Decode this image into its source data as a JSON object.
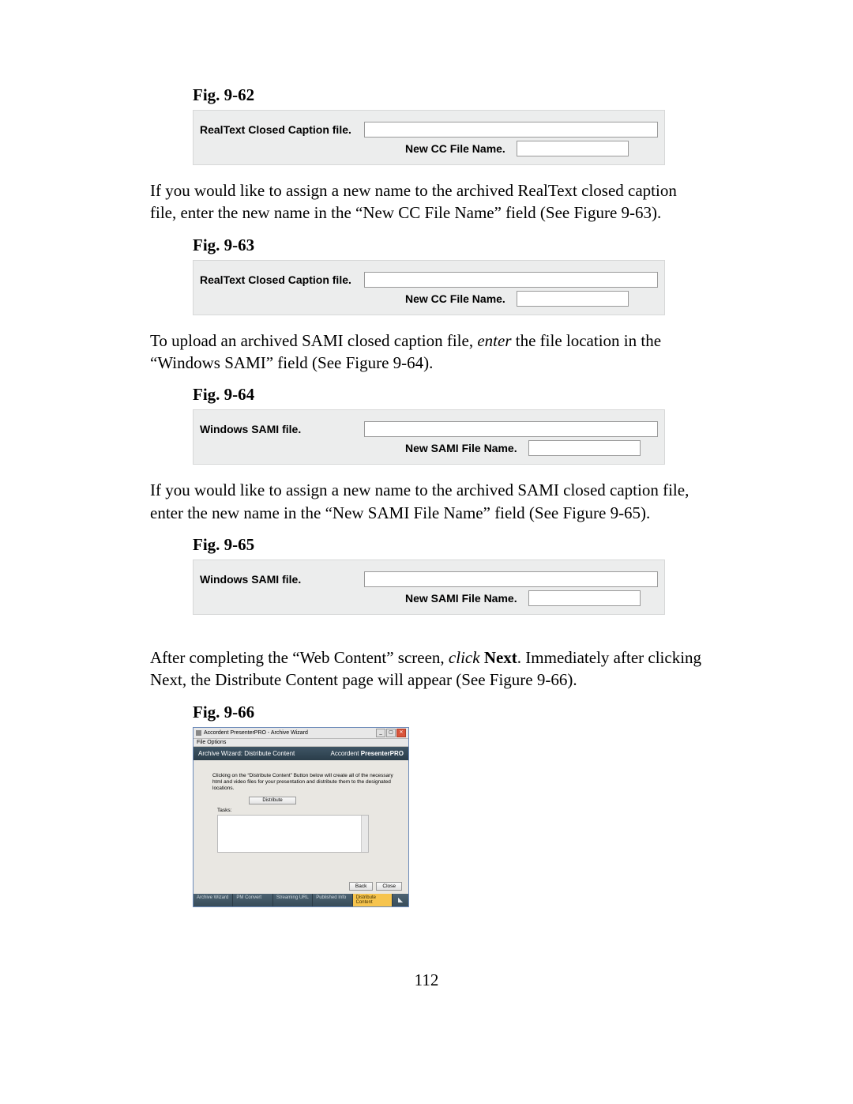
{
  "fig62": {
    "label": "Fig. 9-62",
    "row1_label": "RealText Closed Caption file.",
    "row2_label": "New CC File Name."
  },
  "para1_a": "If you would like to assign a new name to the archived RealText closed caption file, enter the ",
  "para1_b": "new name in the “New CC File Name” field (See Figure 9-63).",
  "fig63": {
    "label": "Fig. 9-63",
    "row1_label": "RealText Closed Caption file.",
    "row2_label": "New CC File Name."
  },
  "para2_a": "To upload an archived SAMI closed caption file, ",
  "para2_em": "enter",
  "para2_b": " the file location in the “Windows SAMI” field (See Figure 9-64).",
  "fig64": {
    "label": "Fig. 9-64",
    "row1_label": "Windows SAMI file.",
    "row2_label": "New SAMI File Name."
  },
  "para3": "If you would like to assign a new name to the archived SAMI closed caption file, enter the new name in the “New SAMI File Name” field (See Figure 9-65).",
  "fig65": {
    "label": "Fig. 9-65",
    "row1_label": "Windows SAMI file.",
    "row2_label": "New SAMI File Name."
  },
  "para4_a": "After completing the “Web Content” screen, ",
  "para4_em": "click",
  "para4_sp": " ",
  "para4_bold": "Next",
  "para4_b": ". Immediately after clicking Next, the Distribute Content page will appear (See Figure 9-66).",
  "fig66": {
    "label": "Fig. 9-66",
    "titlebar": "Accordent PresenterPRO - Archive Wizard",
    "menu": "File   Options",
    "band_left": "Archive Wizard: Distribute Content",
    "band_right_a": "Accordent ",
    "band_right_b": "PresenterPRO",
    "desc": "Clicking on the “Distribute Content” Button below will create all of the necessary html and video files for your presentation and distribute them to the designated locations.",
    "dist_btn": "Distribute",
    "tasks": "Tasks:",
    "btn_back": "Back",
    "btn_close": "Close",
    "status": [
      "Archive Wizard",
      "PM Convert",
      "Streaming URL",
      "Published Info",
      "Distribute Content"
    ]
  },
  "page_number": "112"
}
